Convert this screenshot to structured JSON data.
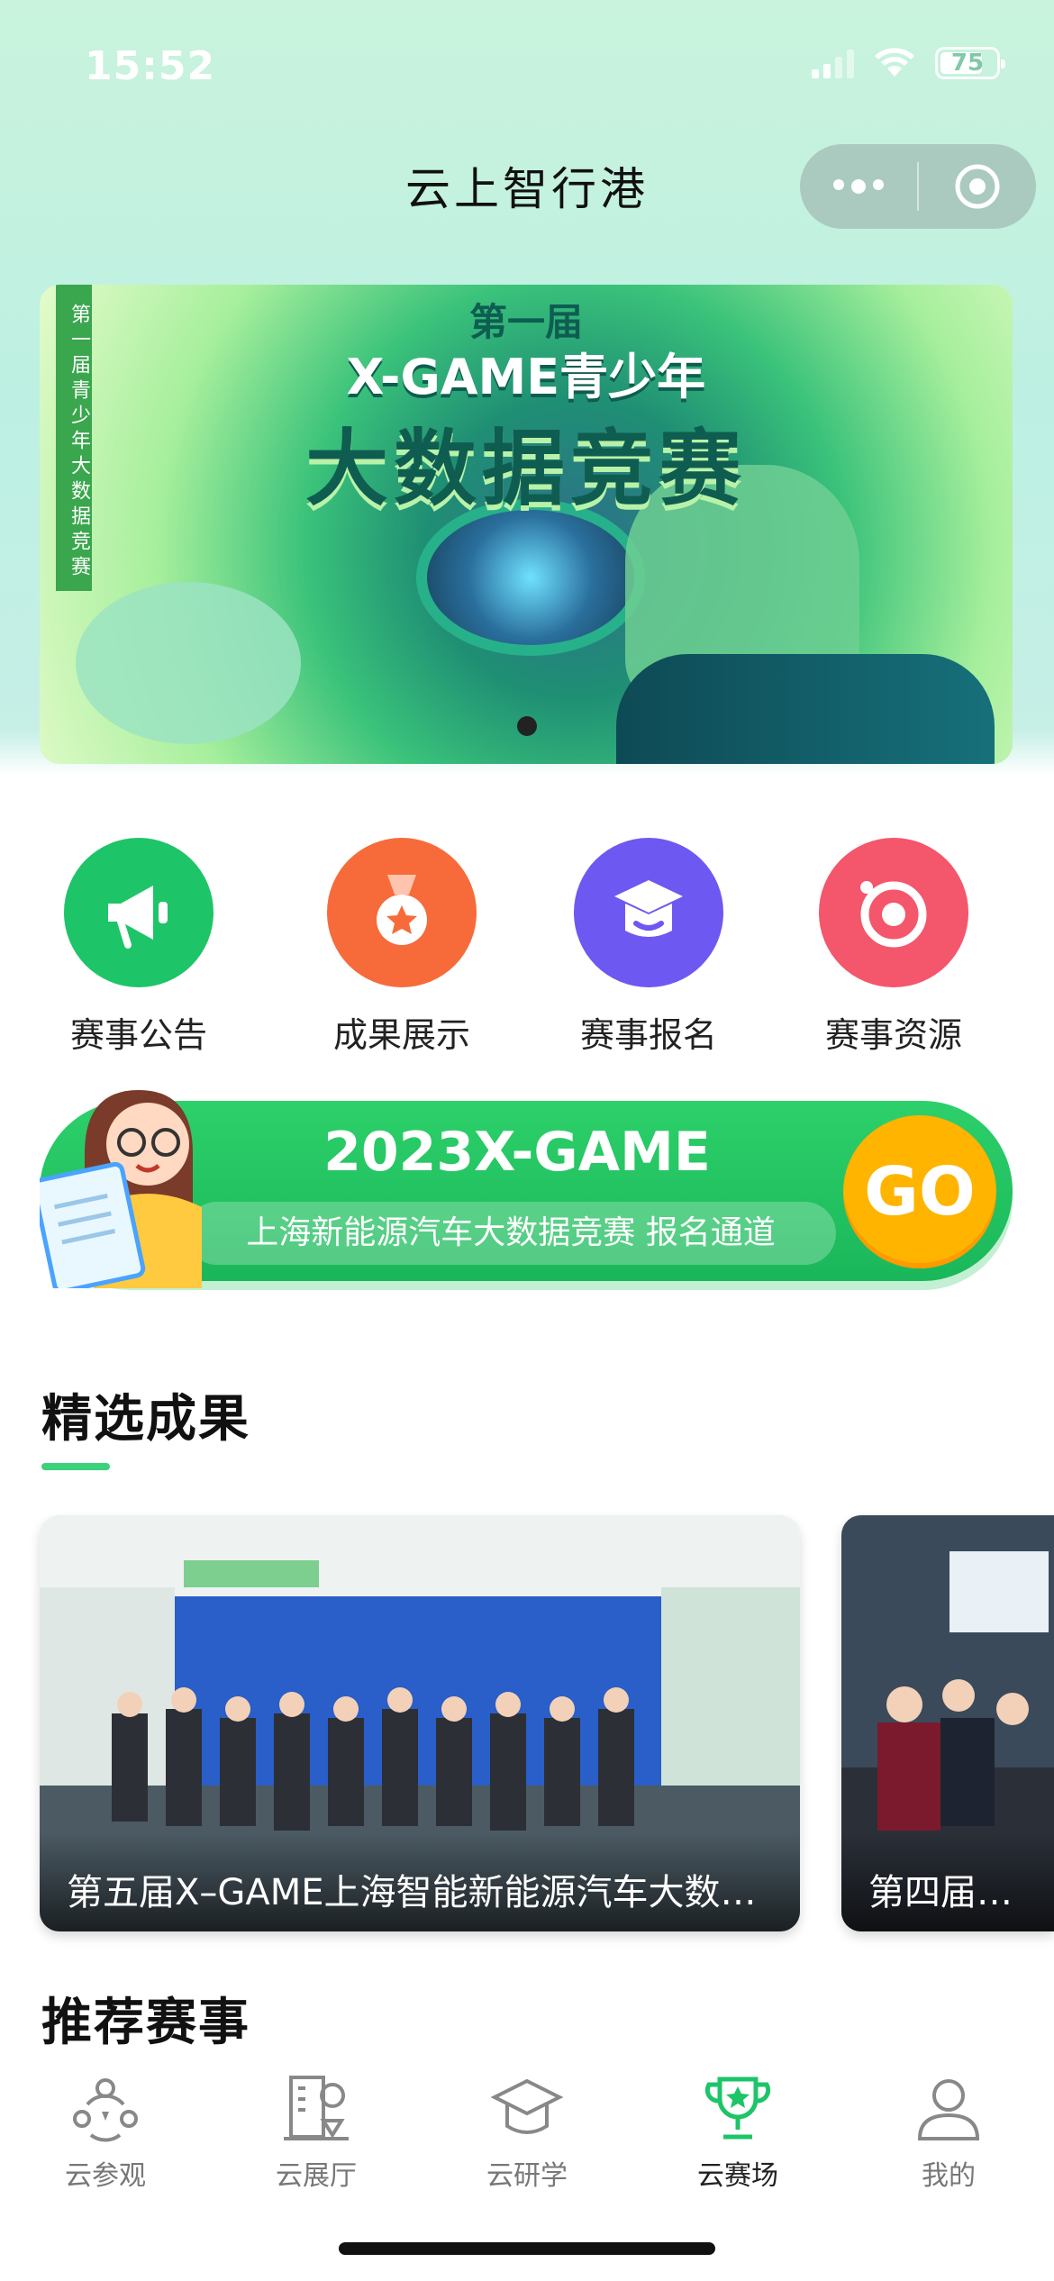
{
  "status_bar": {
    "time": "15:52",
    "battery": "75"
  },
  "header": {
    "title": "云上智行港"
  },
  "banner": {
    "ribbon": "第一届青少年大数据竞赛",
    "line1": "第一届",
    "line2": "X-GAME青少年",
    "line3": "大数据竞赛"
  },
  "quick_actions": [
    {
      "label": "赛事公告",
      "icon": "megaphone-icon",
      "color": "#1ec468"
    },
    {
      "label": "成果展示",
      "icon": "medal-icon",
      "color": "#f76a3a"
    },
    {
      "label": "赛事报名",
      "icon": "graduation-cap-icon",
      "color": "#6d58f2"
    },
    {
      "label": "赛事资源",
      "icon": "target-icon",
      "color": "#f4566b"
    }
  ],
  "promo": {
    "title": "2023X-GAME",
    "subtitle": "上海新能源汽车大数据竞赛 报名通道",
    "go": "GO"
  },
  "featured": {
    "title": "精选成果",
    "cards": [
      {
        "caption": "第五届X–GAME上海智能新能源汽车大数据竞赛"
      },
      {
        "caption": "第四届X–GAME"
      }
    ]
  },
  "recommended": {
    "title": "推荐赛事"
  },
  "tabbar": [
    {
      "label": "云参观",
      "icon": "tour-icon"
    },
    {
      "label": "云展厅",
      "icon": "exhibition-icon"
    },
    {
      "label": "云研学",
      "icon": "study-cap-icon"
    },
    {
      "label": "云赛场",
      "icon": "trophy-icon",
      "active": true
    },
    {
      "label": "我的",
      "icon": "profile-icon"
    }
  ],
  "colors": {
    "accent": "#1ec468",
    "go": "#ffb400"
  }
}
